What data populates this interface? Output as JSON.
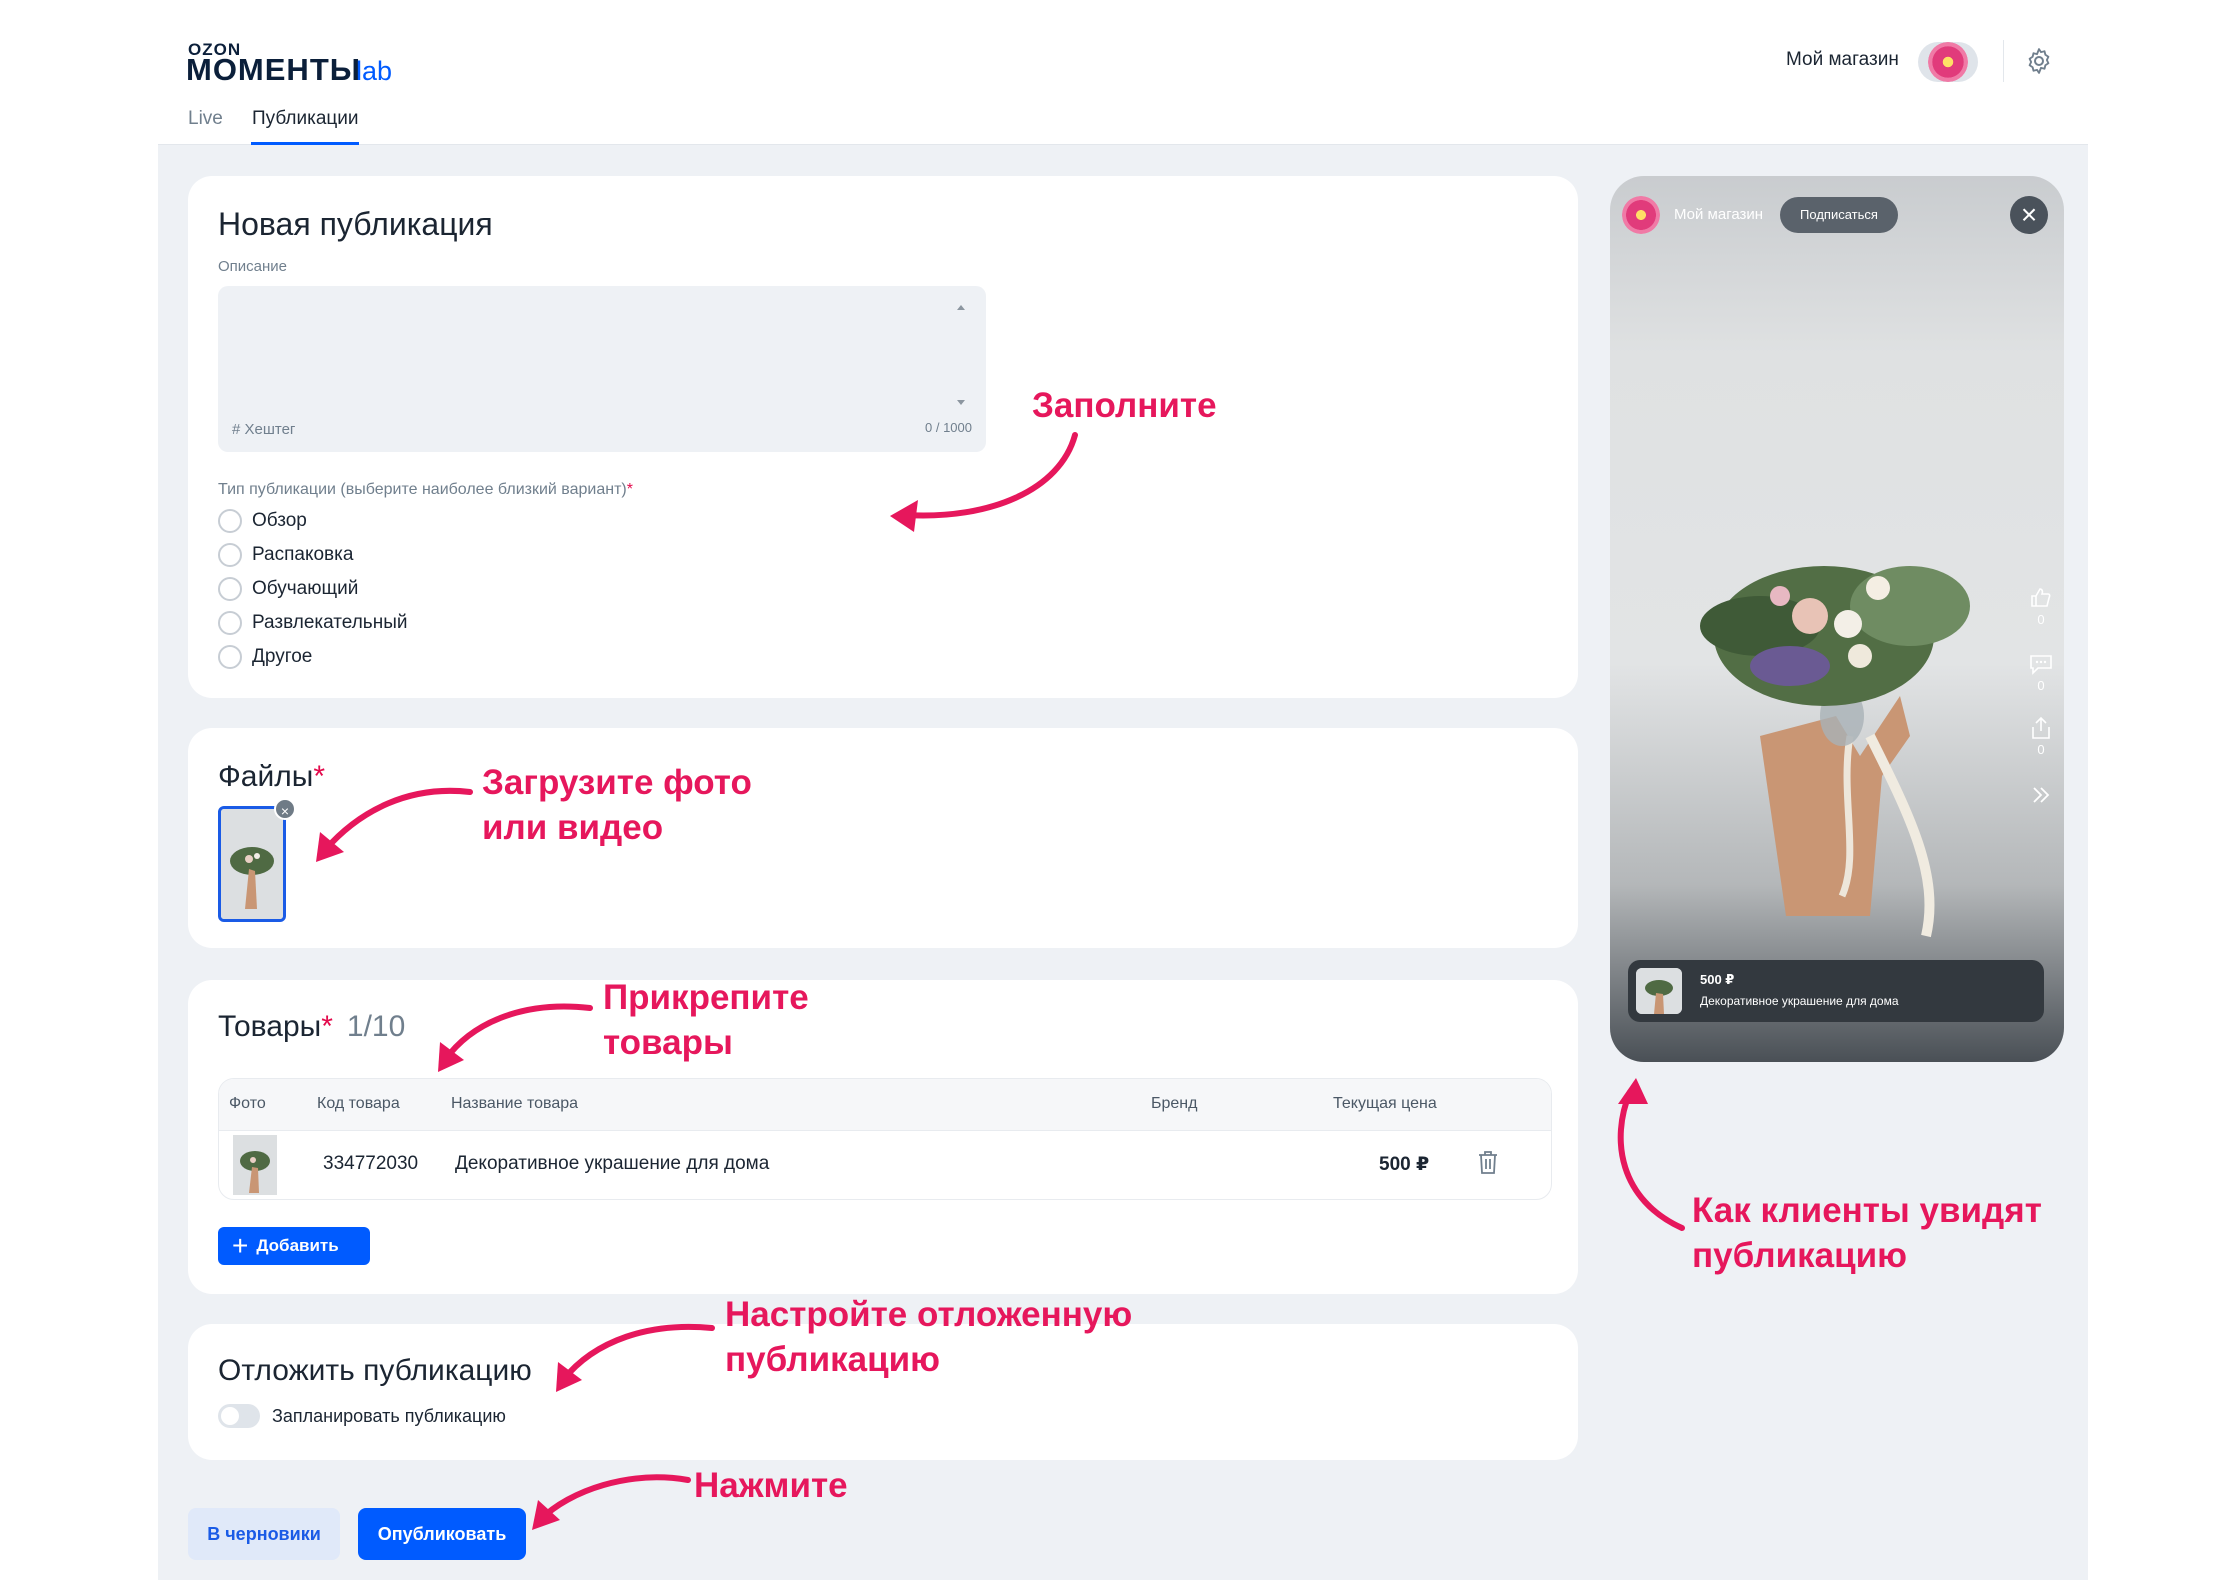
{
  "header": {
    "logo_top": "OZON",
    "logo_main": "МОМЕНТЫ",
    "logo_suffix": "lab",
    "tabs": [
      {
        "label": "Live"
      },
      {
        "label": "Публикации"
      }
    ],
    "shop_name": "Мой магазин"
  },
  "new_post": {
    "title": "Новая публикация",
    "description_label": "Описание",
    "hashtag_hint": "# Хештег",
    "char_count": "0 / 1000",
    "type_label": "Тип публикации (выберите наиболее близкий вариант)",
    "required_mark": "*",
    "types": [
      "Обзор",
      "Распаковка",
      "Обучающий",
      "Развлекательный",
      "Другое"
    ]
  },
  "files": {
    "title": "Файлы",
    "required_mark": "*"
  },
  "products": {
    "title": "Товары",
    "required_mark": "*",
    "count": "1/10",
    "columns": [
      "Фото",
      "Код товара",
      "Название товара",
      "Бренд",
      "Текущая цена"
    ],
    "rows": [
      {
        "code": "334772030",
        "name": "Декоративное украшение для дома",
        "brand": "",
        "price": "500 ₽"
      }
    ],
    "add_label": "Добавить"
  },
  "schedule": {
    "title": "Отложить публикацию",
    "toggle_label": "Запланировать публикацию",
    "toggle_on": false
  },
  "actions": {
    "draft": "В черновики",
    "publish": "Опубликовать"
  },
  "preview": {
    "shop_name": "Мой магазин",
    "subscribe": "Подписаться",
    "close": "×",
    "counts": [
      "0",
      "0",
      "0"
    ],
    "product_price": "500 ₽",
    "product_title": "Декоративное украшение для дома"
  },
  "annotations": {
    "fill": "Заполните",
    "upload": [
      "Загрузите фото",
      "или видео"
    ],
    "attach": [
      "Прикрепите",
      "товары"
    ],
    "schedule": [
      "Настройте отложенную",
      "публикацию"
    ],
    "press": "Нажмите",
    "preview": [
      "Как клиенты увидят",
      "публикацию"
    ]
  },
  "colors": {
    "accent": "#005bff",
    "annotation": "#e6175c",
    "background": "#eef1f5"
  }
}
